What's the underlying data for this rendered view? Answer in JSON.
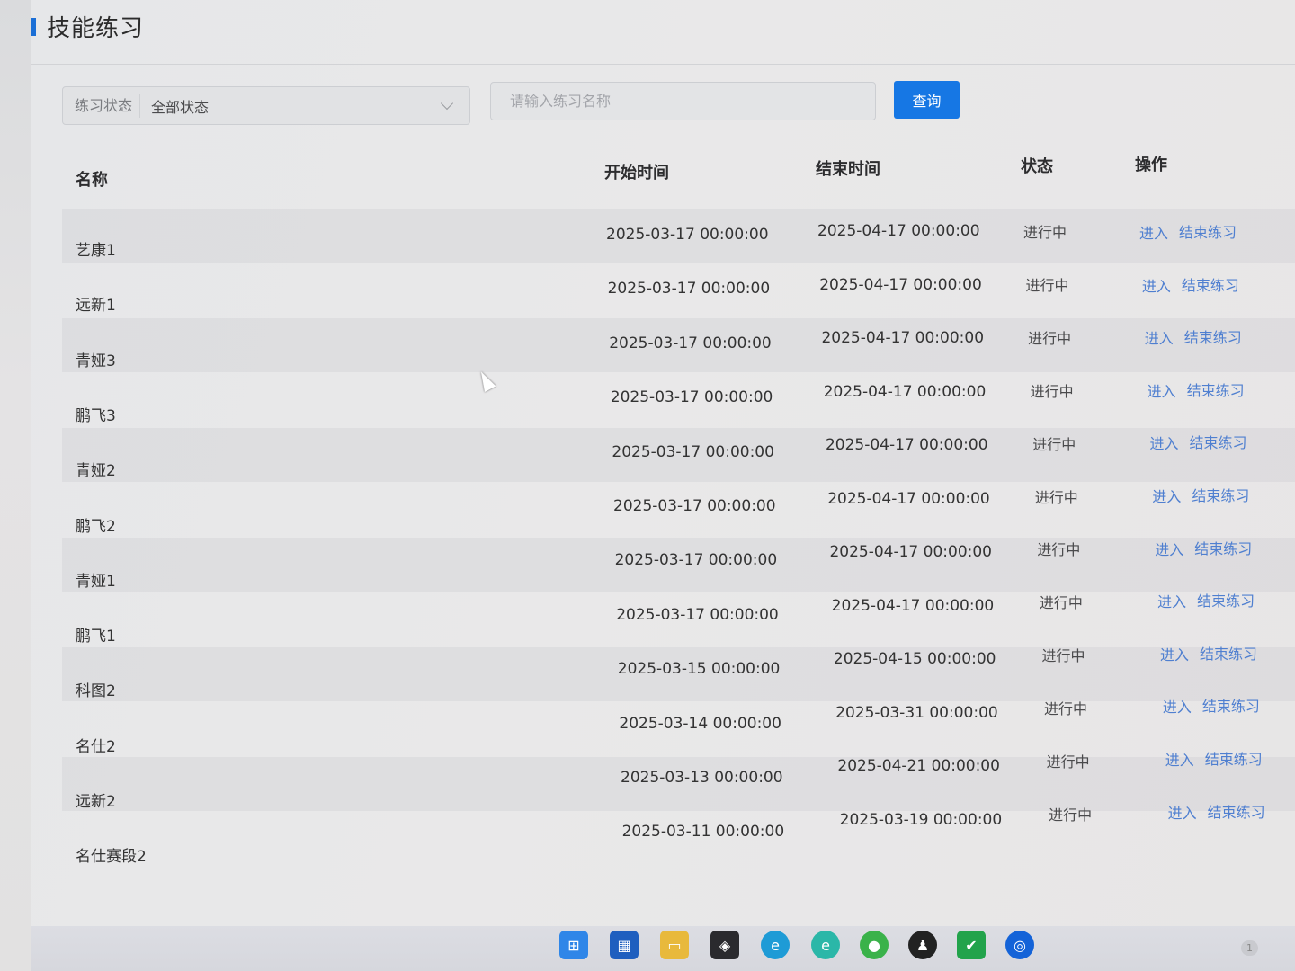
{
  "page": {
    "title": "技能练习"
  },
  "filters": {
    "status_label": "练习状态",
    "status_value": "全部状态",
    "search_placeholder": "请输入练习名称",
    "query_button": "查询"
  },
  "table": {
    "headers": {
      "name": "名称",
      "start": "开始时间",
      "end": "结束时间",
      "status": "状态",
      "action": "操作"
    },
    "actions": {
      "enter": "进入",
      "finish": "结束练习"
    },
    "rows": [
      {
        "name": "艺康1",
        "start": "2025-03-17 00:00:00",
        "end": "2025-04-17 00:00:00",
        "status": "进行中"
      },
      {
        "name": "远新1",
        "start": "2025-03-17 00:00:00",
        "end": "2025-04-17 00:00:00",
        "status": "进行中"
      },
      {
        "name": "青娅3",
        "start": "2025-03-17 00:00:00",
        "end": "2025-04-17 00:00:00",
        "status": "进行中"
      },
      {
        "name": "鹏飞3",
        "start": "2025-03-17 00:00:00",
        "end": "2025-04-17 00:00:00",
        "status": "进行中"
      },
      {
        "name": "青娅2",
        "start": "2025-03-17 00:00:00",
        "end": "2025-04-17 00:00:00",
        "status": "进行中"
      },
      {
        "name": "鹏飞2",
        "start": "2025-03-17 00:00:00",
        "end": "2025-04-17 00:00:00",
        "status": "进行中"
      },
      {
        "name": "青娅1",
        "start": "2025-03-17 00:00:00",
        "end": "2025-04-17 00:00:00",
        "status": "进行中"
      },
      {
        "name": "鹏飞1",
        "start": "2025-03-17 00:00:00",
        "end": "2025-04-17 00:00:00",
        "status": "进行中"
      },
      {
        "name": "科图2",
        "start": "2025-03-15 00:00:00",
        "end": "2025-04-15 00:00:00",
        "status": "进行中"
      },
      {
        "name": "名仕2",
        "start": "2025-03-14 00:00:00",
        "end": "2025-03-31 00:00:00",
        "status": "进行中"
      },
      {
        "name": "远新2",
        "start": "2025-03-13 00:00:00",
        "end": "2025-04-21 00:00:00",
        "status": "进行中"
      },
      {
        "name": "名仕赛段2",
        "start": "2025-03-11 00:00:00",
        "end": "2025-03-19 00:00:00",
        "status": "进行中"
      }
    ]
  },
  "taskbar": {
    "icons": [
      "windows-start-icon",
      "store-icon",
      "file-explorer-icon",
      "app-cube-icon",
      "edge-icon",
      "edge-ai-icon",
      "wechat-icon",
      "qq-icon",
      "green-app-icon",
      "browser-icon"
    ],
    "badge_count": "1"
  }
}
